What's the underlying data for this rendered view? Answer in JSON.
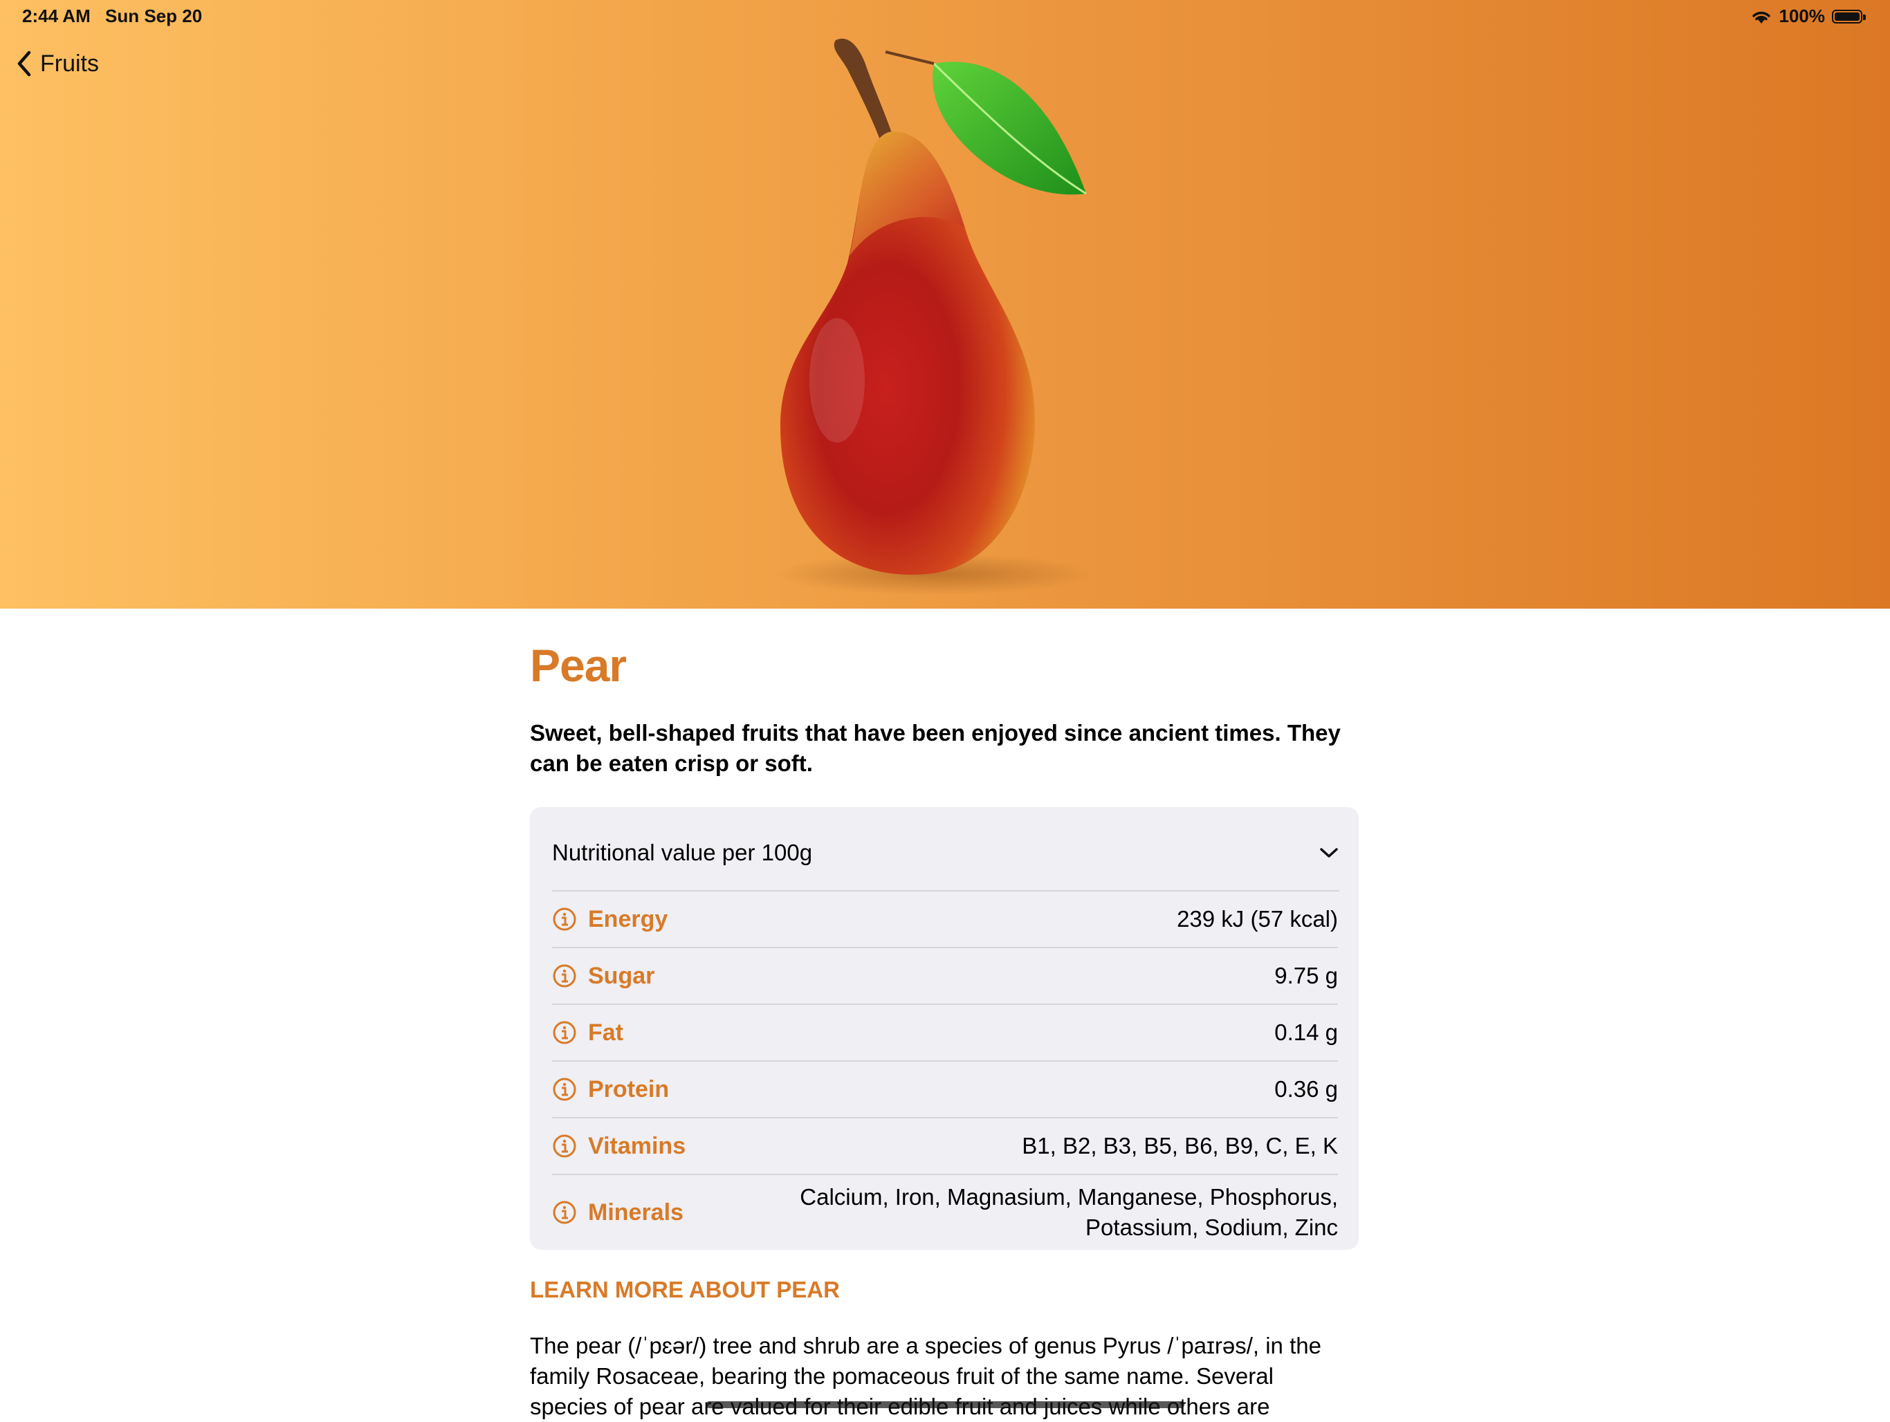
{
  "status_bar": {
    "time": "2:44 AM",
    "date": "Sun Sep 20",
    "battery_text": "100%"
  },
  "nav": {
    "back_label": "Fruits"
  },
  "fruit": {
    "name": "Pear",
    "summary": "Sweet, bell-shaped fruits that have been enjoyed since ancient times. They can be eaten crisp or soft.",
    "image_icon": "pear-image"
  },
  "nutrition": {
    "header_label": "Nutritional value per 100g",
    "rows": [
      {
        "label": "Energy",
        "value": "239 kJ (57 kcal)"
      },
      {
        "label": "Sugar",
        "value": "9.75 g"
      },
      {
        "label": "Fat",
        "value": "0.14 g"
      },
      {
        "label": "Protein",
        "value": "0.36 g"
      },
      {
        "label": "Vitamins",
        "value": "B1, B2, B3, B5, B6, B9, C, E, K"
      },
      {
        "label": "Minerals",
        "value_line1": "Calcium, Iron, Magnasium, Manganese, Phosphorus,",
        "value_line2": "Potassium, Sodium, Zinc"
      }
    ]
  },
  "learn_more": {
    "heading": "LEARN MORE ABOUT PEAR",
    "body": "The pear (/ˈpɛər/) tree and shrub are a species of genus Pyrus /ˈpaɪrəs/, in the family Rosaceae, bearing the pomaceous fruit of the same name. Several species of pear are valued for their edible fruit and juices while others are"
  },
  "colors": {
    "accent": "#d87a27",
    "hero_gradient_start": "#fdc062",
    "hero_gradient_end": "#dc7825",
    "card_background": "#efeff4"
  }
}
